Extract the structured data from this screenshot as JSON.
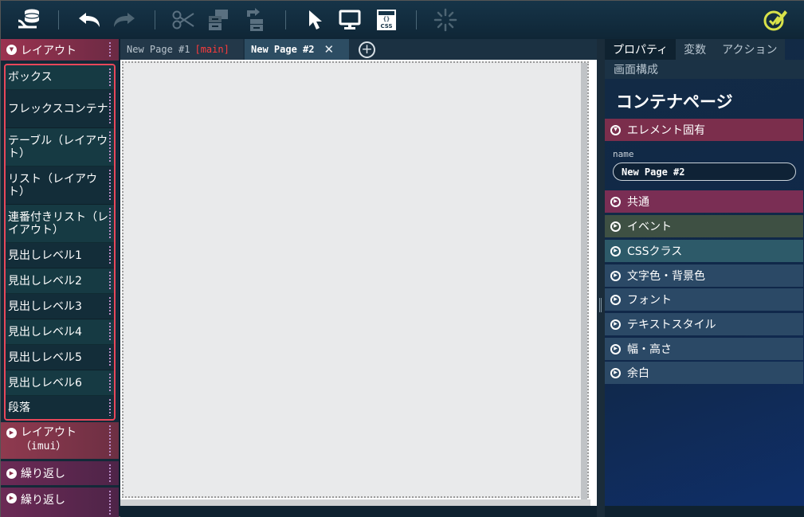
{
  "toolbar": {
    "logo_icon": "data-tree-icon",
    "undo_icon": "undo-icon",
    "redo_icon": "redo-icon",
    "cut_icon": "scissors-icon",
    "copy_icon": "copy-blocks-icon",
    "paste_icon": "paste-blocks-icon",
    "select_icon": "pointer-icon",
    "preview_icon": "monitor-icon",
    "css_icon": "css-file-icon",
    "css_label": "CSS",
    "loading_icon": "spinner-icon",
    "edit_icon": "edit-check-icon"
  },
  "palette": {
    "layout_header": "レイアウト",
    "items": [
      "ボックス",
      "フレックスコンテナ",
      "テーブル（レイアウト）",
      "リスト（レイアウト）",
      "連番付きリスト（レイアウト）",
      "見出しレベル1",
      "見出しレベル2",
      "見出しレベル3",
      "見出しレベル4",
      "見出しレベル5",
      "見出しレベル6",
      "段落"
    ],
    "imui_header_1": "レイアウト",
    "imui_header_2": "（imui）",
    "repeat_header": "繰り返し",
    "repeat2_header": "繰り返し"
  },
  "tabs": {
    "tab1_label": "New Page #1",
    "tab1_badge": "[main]",
    "tab2_label": "New Page #2",
    "tab2_close": "✕",
    "add_label": "+"
  },
  "right_panel": {
    "tabs": [
      "プロパティ",
      "変数",
      "アクション"
    ],
    "tab_structure": "画面構成",
    "title": "コンテナページ",
    "element_section": "エレメント固有",
    "name_label": "name",
    "name_value": "New Page #2",
    "sections": [
      "共通",
      "イベント",
      "CSSクラス",
      "文字色・背景色",
      "フォント",
      "テキストスタイル",
      "幅・高さ",
      "余白"
    ]
  },
  "colors": {
    "layout_header": "#9b3350",
    "highlight_border": "#e8475a",
    "common_section": "#7a2e52",
    "event_section": "#3f5145",
    "css_section": "#2e5a6a",
    "style_sections": "#2c4a68",
    "main_badge": "#ff3b3b"
  }
}
